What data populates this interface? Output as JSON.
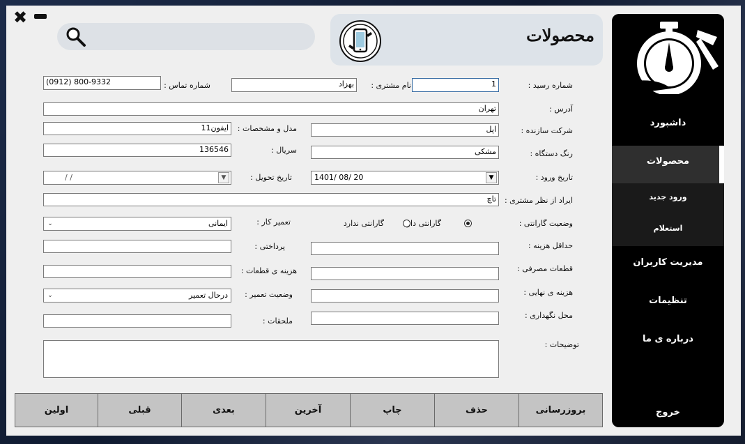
{
  "window": {
    "close_glyph": "✖",
    "minimize_glyph": "▬"
  },
  "header": {
    "title": "محصولات",
    "logo_icon": "phone-repair-icon"
  },
  "search": {
    "placeholder": "",
    "icon": "search-icon"
  },
  "sidebar": {
    "logo_icon": "stopwatch-hammer-icon",
    "items": [
      {
        "label": "داشبورد"
      },
      {
        "label": "محصولات"
      },
      {
        "label": "ورود جدید"
      },
      {
        "label": "استعلام"
      },
      {
        "label": "مدیریت کاربران"
      },
      {
        "label": "تنظیمات"
      },
      {
        "label": "درباره ی ما"
      },
      {
        "label": "خروج"
      }
    ]
  },
  "form": {
    "receipt_no": {
      "label": "شماره رسید :",
      "value": "1"
    },
    "customer_name": {
      "label": "نام مشتری :",
      "value": "بهزاد"
    },
    "phone": {
      "label": "شماره تماس :",
      "value": "(0912) 800-9332"
    },
    "address": {
      "label": "آدرس :",
      "value": "تهران"
    },
    "manufacturer": {
      "label": "شرکت سازنده :",
      "value": "اپل"
    },
    "model": {
      "label": "مدل و مشخصات :",
      "value": "ایفون11"
    },
    "device_color": {
      "label": "رنگ دستگاه :",
      "value": "مشکی"
    },
    "serial": {
      "label": "سریال :",
      "value": "136546"
    },
    "entry_date": {
      "label": "تاریخ ورود :",
      "value": "1401/ 08/ 20"
    },
    "delivery_date": {
      "label": "تاریخ تحویل :",
      "value": "/     /"
    },
    "customer_issue": {
      "label": "ایراد از نظر مشتری :",
      "value": "تاچ"
    },
    "warranty": {
      "label": "وضعیت گارانتی :",
      "option_yes": "گارانتی دارد",
      "option_no": "گارانتی ندارد",
      "selected": "yes"
    },
    "technician": {
      "label": "تعمیر کار :",
      "value": "ایمانی"
    },
    "min_cost": {
      "label": "حداقل هزینه :",
      "value": ""
    },
    "paid": {
      "label": "پرداختی :",
      "value": ""
    },
    "parts_used": {
      "label": "قطعات مصرفی :",
      "value": ""
    },
    "parts_cost": {
      "label": "هزینه ی قطعات :",
      "value": ""
    },
    "final_cost": {
      "label": "هزینه ی نهایی :",
      "value": ""
    },
    "repair_status": {
      "label": "وضعیت تعمیر :",
      "value": "درحال تعمیر"
    },
    "storage": {
      "label": "محل نگهداری :",
      "value": ""
    },
    "accessories": {
      "label": "ملحقات :",
      "value": ""
    },
    "notes": {
      "label": "توضیحات :",
      "value": ""
    }
  },
  "buttons": {
    "update": "بروزرسانی",
    "delete": "حذف",
    "print": "چاپ",
    "last": "آخرین",
    "next": "بعدی",
    "previous": "قبلی",
    "first": "اولین"
  }
}
